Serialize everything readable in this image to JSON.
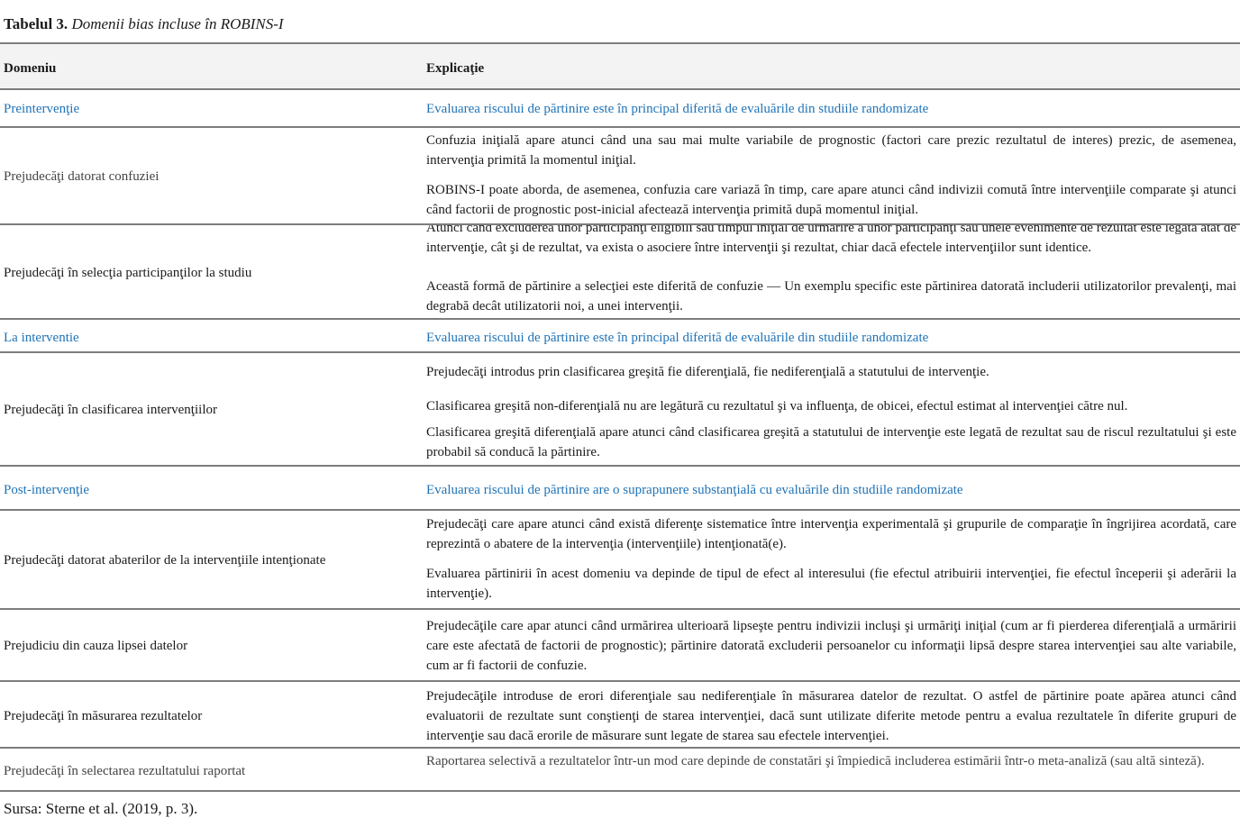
{
  "caption": {
    "label": "Tabelul 3.",
    "title": "Domenii bias incluse în ROBINS-I"
  },
  "header": {
    "col1": "Domeniu",
    "col2": "Explicaţie"
  },
  "rows": [
    {
      "domain": "Preintervenţie",
      "explanation": [
        "Evaluarea riscului de părtinire este în principal diferită de evaluările din studiile randomizate"
      ]
    },
    {
      "domain": "Prejudecăţi datorat confuziei",
      "explanation": [
        "Confuzia iniţială apare atunci când una sau mai multe variabile de prognostic (factori care prezic rezultatul de interes) prezic, de asemenea, intervenţia primită la momentul iniţial.",
        "ROBINS-I poate aborda, de asemenea, confuzia care variază în timp, care apare atunci când indivizii comută între intervenţiile comparate şi atunci când factorii de prognostic post-inicial afectează intervenţia primită după momentul iniţial."
      ]
    },
    {
      "domain": "Prejudecăţi în selecţia participanţilor la studiu",
      "explanation": [
        "Atunci când excluderea unor participanţi eligibili sau timpul iniţial de urmărire a unor participanţi sau unele evenimente de rezultat este legată atât de intervenţie, cât şi de rezultat, va exista o asociere între intervenţii şi rezultat, chiar dacă efectele intervenţiilor sunt identice.",
        "Această formă de părtinire a selecţiei este diferită de confuzie — Un exemplu specific este părtinirea datorată includerii utilizatorilor prevalenţi, mai degrabă decât utilizatorii noi, a unei intervenţii."
      ]
    },
    {
      "domain": "La interventie",
      "explanation": [
        "Evaluarea riscului de părtinire este în principal diferită de evaluările din studiile randomizate"
      ]
    },
    {
      "domain": "Prejudecăţi în clasificarea intervenţiilor",
      "explanation": [
        "Prejudecăţi introdus prin clasificarea greşită fie diferenţială, fie nediferenţială a statutului de intervenţie.",
        "Clasificarea greşită non-diferenţială nu are legătură cu rezultatul şi va influenţa, de obicei, efectul estimat al intervenţiei către nul.",
        "Clasificarea greşită diferenţială apare atunci când clasificarea greşită a statutului de intervenţie este legată de rezultat sau de riscul rezultatului şi este probabil să conducă la părtinire."
      ]
    },
    {
      "domain": "Post-intervenţie",
      "explanation": [
        "Evaluarea riscului de părtinire are o suprapunere substanţială cu evaluările din studiile randomizate"
      ]
    },
    {
      "domain": "Prejudecăţi datorat abaterilor de la intervenţiile intenţionate",
      "explanation": [
        "Prejudecăţi care apare atunci când există diferenţe sistematice între intervenţia experimentală şi grupurile de comparaţie în îngrijirea acordată, care reprezintă o abatere de la intervenţia (intervenţiile) intenţionată(e).",
        "Evaluarea părtinirii în acest domeniu va depinde de tipul de efect al interesului (fie efectul atribuirii intervenţiei, fie efectul începerii şi aderării la intervenţie)."
      ]
    },
    {
      "domain": "Prejudiciu din cauza lipsei datelor",
      "explanation": [
        "Prejudecăţile care apar atunci când urmărirea ulterioară lipseşte pentru indivizii incluşi şi urmăriţi iniţial (cum ar fi pierderea diferenţială a urmăririi care este afectată de factorii de prognostic); părtinire datorată excluderii persoanelor cu informaţii lipsă despre starea intervenţiei sau alte variabile, cum ar fi factorii de confuzie."
      ]
    },
    {
      "domain": "Prejudecăţi în măsurarea rezultatelor",
      "explanation": [
        "Prejudecăţile introduse de erori diferenţiale sau nediferenţiale în măsurarea datelor de rezultat. O astfel de părtinire poate apărea atunci când evaluatorii de rezultate sunt conştienţi de starea intervenţiei, dacă sunt utilizate diferite metode pentru a evalua rezultatele în diferite grupuri de intervenţie sau dacă erorile de măsurare sunt legate de starea sau efectele intervenţiei."
      ]
    },
    {
      "domain": "Prejudecăţi în selectarea rezultatului raportat",
      "explanation": [
        "Raportarea selectivă a rezultatelor într-un mod care depinde de constatări şi împiedică includerea estimării într-o meta-analiză (sau altă sinteză)."
      ]
    }
  ],
  "source": "Sursa: Sterne et al. (2019, p. 3)."
}
